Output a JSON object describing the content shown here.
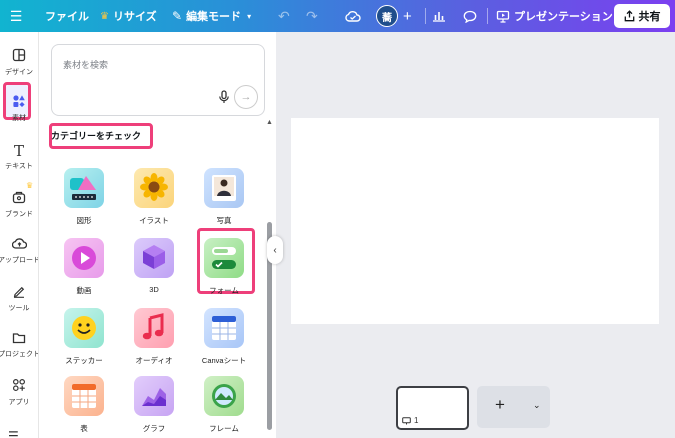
{
  "topbar": {
    "menu_icon": "hamburger-icon",
    "file": "ファイル",
    "resize": "リサイズ",
    "edit_mode": "編集モード",
    "avatar_initial": "蕎",
    "presentation": "プレゼンテーション",
    "share": "共有"
  },
  "rail": {
    "items": [
      {
        "label": "デザイン",
        "icon": "layout-icon"
      },
      {
        "label": "素材",
        "icon": "elements-icon"
      },
      {
        "label": "テキスト",
        "icon": "text-icon"
      },
      {
        "label": "ブランド",
        "icon": "brand-icon"
      },
      {
        "label": "アップロード",
        "icon": "upload-icon"
      },
      {
        "label": "ツール",
        "icon": "draw-icon"
      },
      {
        "label": "プロジェクト",
        "icon": "folder-icon"
      },
      {
        "label": "アプリ",
        "icon": "apps-icon"
      }
    ]
  },
  "panel": {
    "search_placeholder": "素材を検索",
    "section_title": "カテゴリーをチェック",
    "categories": [
      {
        "label": "図形"
      },
      {
        "label": "イラスト"
      },
      {
        "label": "写真"
      },
      {
        "label": "動画"
      },
      {
        "label": "3D"
      },
      {
        "label": "フォーム"
      },
      {
        "label": "ステッカー"
      },
      {
        "label": "オーディオ"
      },
      {
        "label": "Canvaシート"
      },
      {
        "label": "表"
      },
      {
        "label": "グラフ"
      },
      {
        "label": "フレーム"
      }
    ]
  },
  "pages": {
    "current": "1"
  },
  "colors": {
    "highlight": "#ee3f7a",
    "topbar_start": "#11b4d0",
    "topbar_end": "#7b3ff0"
  }
}
